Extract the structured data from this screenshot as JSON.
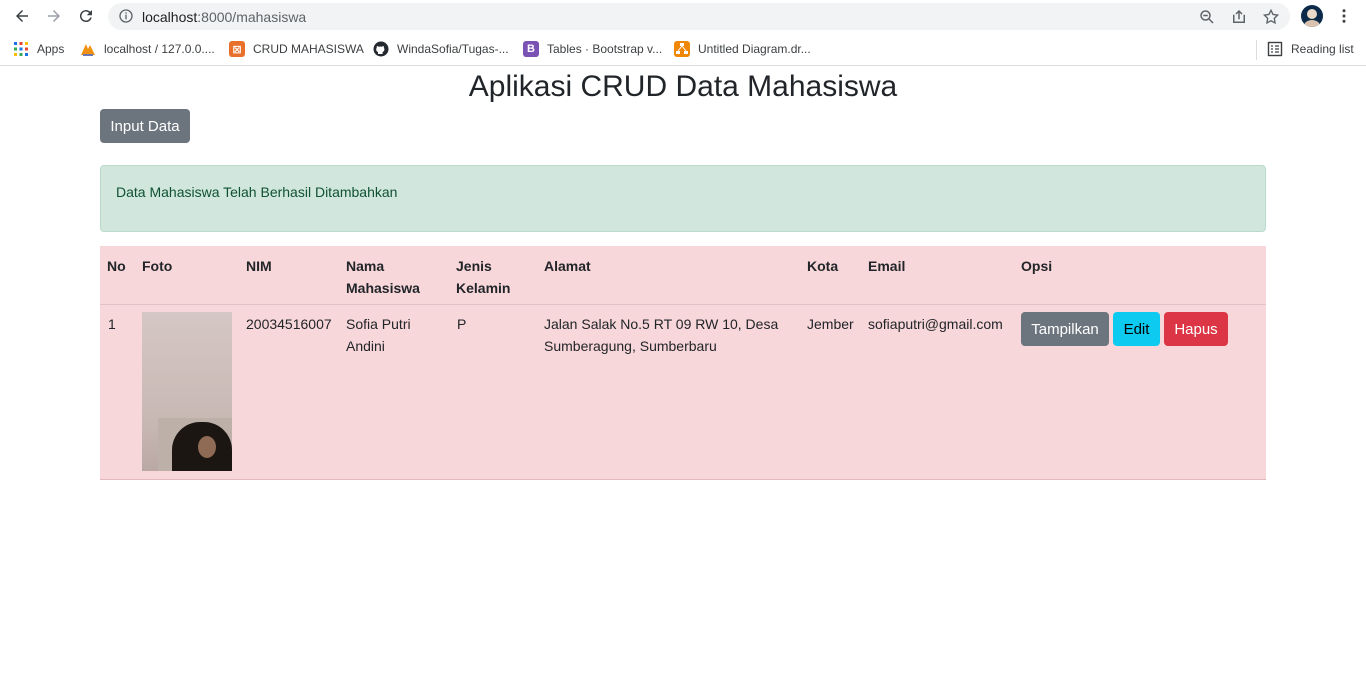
{
  "browser": {
    "url_host": "localhost",
    "url_path": ":8000/mahasiswa",
    "reading_list_label": "Reading list"
  },
  "bookmarks": [
    {
      "label": "Apps"
    },
    {
      "label": "localhost / 127.0.0...."
    },
    {
      "label": "CRUD MAHASISWA"
    },
    {
      "label": "WindaSofia/Tugas-..."
    },
    {
      "label": "Tables · Bootstrap v..."
    },
    {
      "label": "Untitled Diagram.dr..."
    }
  ],
  "page": {
    "title": "Aplikasi CRUD Data Mahasiswa",
    "input_button": "Input Data",
    "alert": "Data Mahasiswa Telah Berhasil Ditambahkan"
  },
  "table": {
    "headers": {
      "no": "No",
      "foto": "Foto",
      "nim": "NIM",
      "nama_1": "Nama",
      "nama_2": "Mahasiswa",
      "jk_1": "Jenis",
      "jk_2": "Kelamin",
      "alamat": "Alamat",
      "kota": "Kota",
      "email": "Email",
      "opsi": "Opsi"
    },
    "rows": [
      {
        "no": "1",
        "nim": "20034516007",
        "nama_1": "Sofia Putri",
        "nama_2": "Andini",
        "jenis_kelamin": "P",
        "alamat_1": "Jalan Salak No.5 RT 09 RW 10, Desa",
        "alamat_2": "Sumberagung, Sumberbaru",
        "kota": "Jember",
        "email": "sofiaputri@gmail.com",
        "btn_show": "Tampilkan",
        "btn_edit": "Edit",
        "btn_delete": "Hapus"
      }
    ]
  },
  "colors": {
    "secondary": "#6c757d",
    "info": "#0dcaf0",
    "danger": "#dc3545",
    "success_bg": "#d1e7dd",
    "table_danger_bg": "#f8d7da"
  }
}
